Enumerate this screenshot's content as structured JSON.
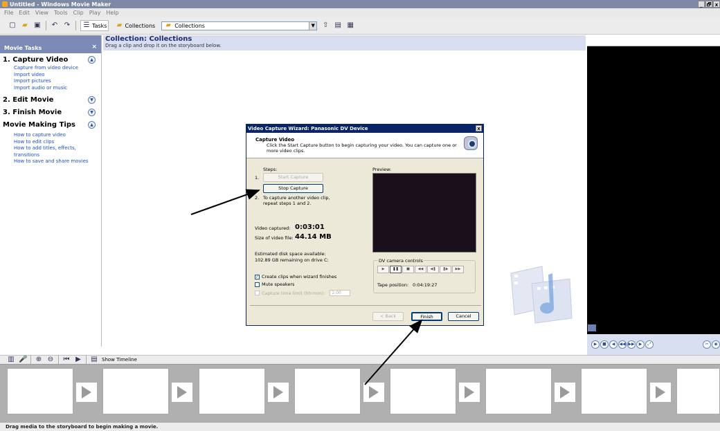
{
  "window": {
    "title": "Untitled - Windows Movie Maker",
    "buttons": [
      "_",
      "🗗",
      "x"
    ]
  },
  "menu": [
    "File",
    "Edit",
    "View",
    "Tools",
    "Clip",
    "Play",
    "Help"
  ],
  "toolbar": {
    "tasks_label": "Tasks",
    "collections_label": "Collections",
    "combo_value": "Collections"
  },
  "tasks": {
    "header": "Movie Tasks",
    "close": "×",
    "sections": [
      {
        "title": "1. Capture Video",
        "links": [
          "Capture from video device",
          "Import video",
          "Import pictures",
          "Import audio or music"
        ]
      },
      {
        "title": "2. Edit Movie",
        "links": []
      },
      {
        "title": "3. Finish Movie",
        "links": []
      },
      {
        "title": "Movie Making Tips",
        "links": [
          "How to capture video",
          "How to edit clips",
          "How to add titles, effects, transitions",
          "How to save and share movies"
        ]
      }
    ]
  },
  "collection": {
    "title": "Collection: Collections",
    "subtitle": "Drag a clip and drop it on the storyboard below."
  },
  "dialog": {
    "title": "Video Capture Wizard: Panasonic DV Device",
    "close": "x",
    "heading": "Capture Video",
    "description": "Click the Start Capture button to begin capturing your video. You can capture one or more video clips.",
    "steps_label": "Steps:",
    "step1_num": "1.",
    "start_capture": "Start Capture",
    "stop_capture": "Stop Capture",
    "step2_num": "2.",
    "step2_text": "To capture another video clip, repeat steps 1 and 2.",
    "preview_label": "Preview:",
    "video_captured_label": "Video captured:",
    "video_captured_value": "0:03:01",
    "size_label": "Size of video file:",
    "size_value": "44.14 MB",
    "disk_label": "Estimated disk space available:",
    "disk_value": "102.89 GB remaining on drive C:",
    "dv_controls_label": "DV camera controls",
    "dv_buttons": [
      "▶",
      "❚❚",
      "■",
      "◀◀",
      "◀❚",
      "❚▶",
      "▶▶"
    ],
    "tape_position_label": "Tape position:",
    "tape_position_value": "0:04:19:27",
    "create_clips": "Create clips when wizard finishes",
    "create_clips_checked": "✓",
    "mute_speakers": "Mute speakers",
    "capture_limit": "Capture time limit (hh:mm):",
    "capture_limit_value": "2:00",
    "back": "< Back",
    "finish": "Finish",
    "cancel": "Cancel"
  },
  "storyboard": {
    "show_timeline": "Show Timeline",
    "status": "Drag media to the storyboard to begin making a movie."
  }
}
